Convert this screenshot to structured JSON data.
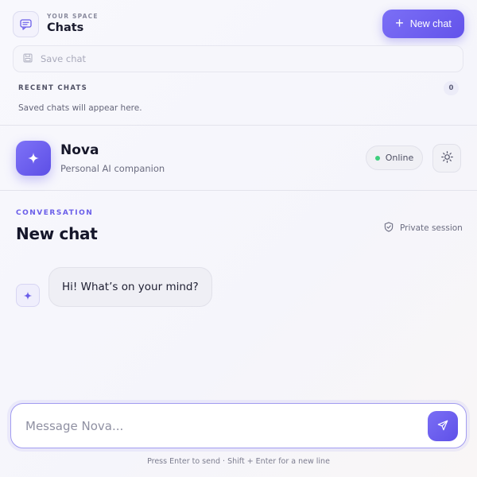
{
  "sidebar": {
    "eyebrow": "YOUR SPACE",
    "title": "Chats",
    "new_chat_label": "New chat",
    "save_chat_label": "Save chat",
    "recent_label": "RECENT CHATS",
    "recent_count": "0",
    "empty_text": "Saved chats will appear here."
  },
  "assistant": {
    "name": "Nova",
    "subtitle": "Personal AI companion",
    "status": "Online"
  },
  "conversation": {
    "eyebrow": "CONVERSATION",
    "title": "New chat",
    "privacy_label": "Private session",
    "messages": [
      {
        "role": "assistant",
        "text": "Hi! What’s on your mind?"
      }
    ]
  },
  "composer": {
    "placeholder": "Message Nova...",
    "value": "",
    "hint": "Press Enter to send · Shift + Enter for a new line"
  },
  "icons": {
    "space": "chat-bubble-icon",
    "new_chat": "plus-icon",
    "save_chat": "floppy-disk-icon",
    "avatar": "sparkle-icon",
    "theme": "sun-icon",
    "privacy": "shield-check-icon",
    "send": "send-arrow-icon"
  },
  "colors": {
    "accent": "#6b5df0",
    "online": "#3ecf7d"
  }
}
